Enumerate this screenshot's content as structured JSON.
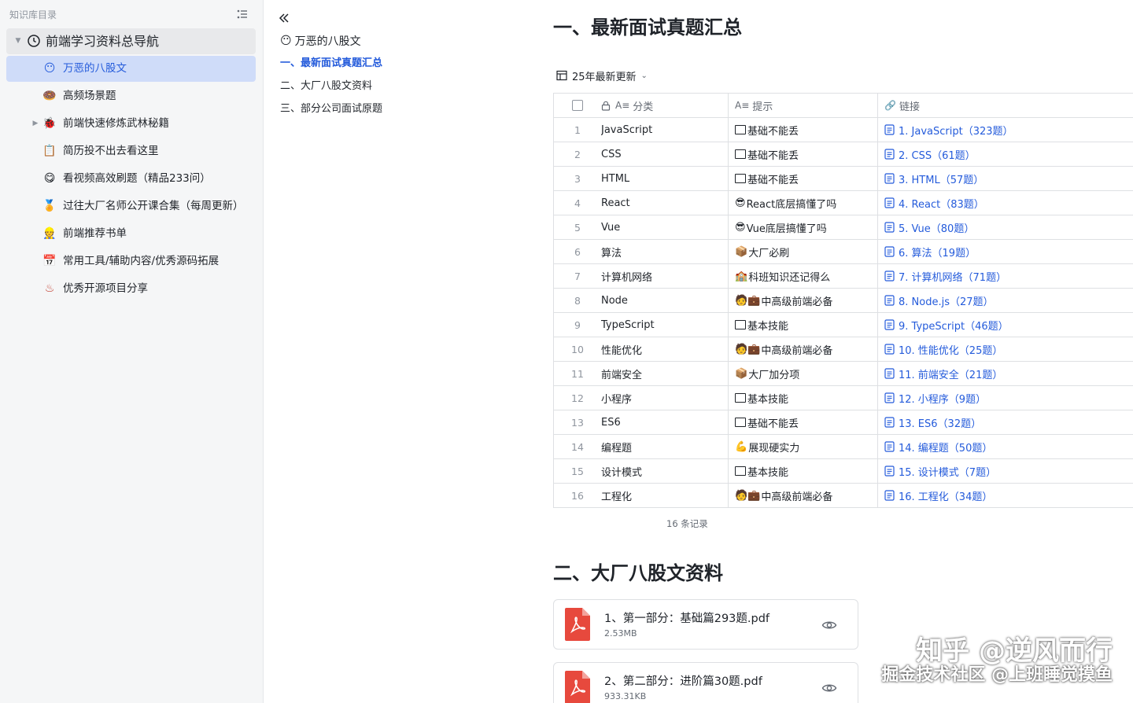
{
  "sidebar": {
    "title": "知识库目录",
    "collapse_icon": "list-collapse-icon",
    "root": {
      "label": "前端学习资料总导航",
      "icon": "clock-icon"
    },
    "items": [
      {
        "label": "万恶的八股文",
        "emoji": "😶",
        "active": true
      },
      {
        "label": "高频场景题",
        "emoji": "🍩"
      },
      {
        "label": "前端快速修炼武林秘籍",
        "emoji": "🐞",
        "expandable": true
      },
      {
        "label": "简历投不出去看这里",
        "emoji": "📋"
      },
      {
        "label": "看视频高效刷题（精品233问）",
        "emoji": "😋"
      },
      {
        "label": "过往大厂名师公开课合集（每周更新）",
        "emoji": "🏅"
      },
      {
        "label": "前端推荐书单",
        "emoji": "👷"
      },
      {
        "label": "常用工具/辅助内容/优秀源码拓展",
        "emoji": "📅"
      },
      {
        "label": "优秀开源项目分享",
        "emoji": "♨"
      }
    ]
  },
  "outline": {
    "back_icon": "double-chevron-left-icon",
    "title": "万恶的八股文",
    "title_emoji": "😶",
    "items": [
      {
        "label": "一、最新面试真题汇总",
        "active": true
      },
      {
        "label": "二、大厂八股文资料"
      },
      {
        "label": "三、部分公司面试原题"
      }
    ]
  },
  "main": {
    "section1_title": "一、最新面试真题汇总",
    "view_name": "25年最新更新",
    "table": {
      "headers": {
        "category": "分类",
        "tip": "提示",
        "link": "链接"
      },
      "rows": [
        {
          "idx": "1",
          "category": "JavaScript",
          "tip_emoji": "☐",
          "tip": "基础不能丢",
          "link": "1. JavaScript（323题）"
        },
        {
          "idx": "2",
          "category": "CSS",
          "tip_emoji": "☐",
          "tip": "基础不能丢",
          "link": "2. CSS（61题）"
        },
        {
          "idx": "3",
          "category": "HTML",
          "tip_emoji": "☐",
          "tip": "基础不能丢",
          "link": "3. HTML（57题）"
        },
        {
          "idx": "4",
          "category": "React",
          "tip_emoji": "😎",
          "tip": "React底层搞懂了吗",
          "link": "4. React（83题）"
        },
        {
          "idx": "5",
          "category": "Vue",
          "tip_emoji": "😎",
          "tip": "Vue底层搞懂了吗",
          "link": "5. Vue（80题）"
        },
        {
          "idx": "6",
          "category": "算法",
          "tip_emoji": "📦",
          "tip": "大厂必刷",
          "link": "6. 算法（19题）"
        },
        {
          "idx": "7",
          "category": "计算机网络",
          "tip_emoji": "🏫",
          "tip": "科班知识还记得么",
          "link": "7. 计算机网络（71题）"
        },
        {
          "idx": "8",
          "category": "Node",
          "tip_emoji": "🧑💼",
          "tip": "中高级前端必备",
          "link": "8. Node.js（27题）"
        },
        {
          "idx": "9",
          "category": "TypeScript",
          "tip_emoji": "☐",
          "tip": "基本技能",
          "link": "9. TypeScript（46题）"
        },
        {
          "idx": "10",
          "category": "性能优化",
          "tip_emoji": "🧑💼",
          "tip": "中高级前端必备",
          "link": "10. 性能优化（25题）"
        },
        {
          "idx": "11",
          "category": "前端安全",
          "tip_emoji": "📦",
          "tip": "大厂加分项",
          "link": "11. 前端安全（21题）"
        },
        {
          "idx": "12",
          "category": "小程序",
          "tip_emoji": "☐",
          "tip": "基本技能",
          "link": "12. 小程序（9题）"
        },
        {
          "idx": "13",
          "category": "ES6",
          "tip_emoji": "☐",
          "tip": "基础不能丢",
          "link": "13. ES6（32题）"
        },
        {
          "idx": "14",
          "category": "编程题",
          "tip_emoji": "💪",
          "tip": "展现硬实力",
          "link": "14. 编程题（50题）"
        },
        {
          "idx": "15",
          "category": "设计模式",
          "tip_emoji": "☐",
          "tip": "基本技能",
          "link": "15. 设计模式（7题）"
        },
        {
          "idx": "16",
          "category": "工程化",
          "tip_emoji": "🧑💼",
          "tip": "中高级前端必备",
          "link": "16. 工程化（34题）"
        }
      ],
      "records": "16 条记录"
    },
    "section2_title": "二、大厂八股文资料",
    "files": [
      {
        "name": "1、第一部分：基础篇293题.pdf",
        "size": "2.53MB"
      },
      {
        "name": "2、第二部分：进阶篇30题.pdf",
        "size": "933.31KB"
      }
    ]
  },
  "watermark": {
    "line1": "知乎 @逆风而行",
    "line2": "掘金技术社区 @上班睡觉摸鱼"
  },
  "colors": {
    "accent": "#245bdb",
    "active_bg": "#cfdcf9",
    "sidebar_bg": "#f5f6f7",
    "pdf_red": "#e7493d"
  }
}
